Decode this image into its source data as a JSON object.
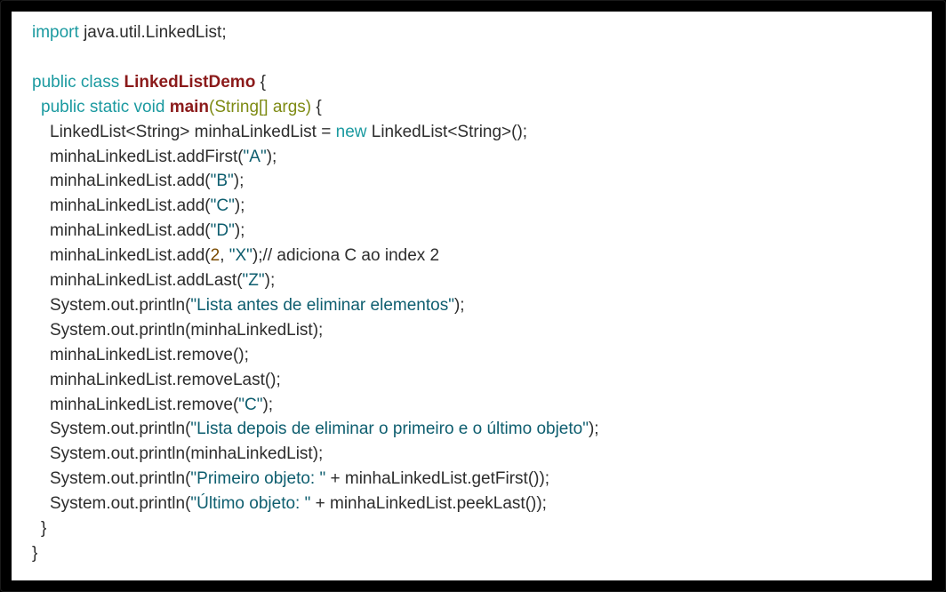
{
  "editor": {
    "lines": [
      {
        "indent": 0,
        "parts": [
          {
            "t": "kw",
            "v": "import"
          },
          {
            "t": "plain",
            "v": " java.util.LinkedList;"
          }
        ]
      },
      {
        "indent": 0,
        "parts": []
      },
      {
        "indent": 0,
        "parts": [
          {
            "t": "kw",
            "v": "public class "
          },
          {
            "t": "cls",
            "v": "LinkedListDemo"
          },
          {
            "t": "plain",
            "v": " {"
          }
        ]
      },
      {
        "indent": 1,
        "parts": [
          {
            "t": "kw",
            "v": "public static void "
          },
          {
            "t": "fn",
            "v": "main"
          },
          {
            "t": "type",
            "v": "(String[] args)"
          },
          {
            "t": "plain",
            "v": " {"
          }
        ]
      },
      {
        "indent": 2,
        "parts": [
          {
            "t": "plain",
            "v": "LinkedList<String> minhaLinkedList = "
          },
          {
            "t": "kw",
            "v": "new"
          },
          {
            "t": "plain",
            "v": " LinkedList<String>();"
          }
        ]
      },
      {
        "indent": 2,
        "parts": [
          {
            "t": "plain",
            "v": "minhaLinkedList.addFirst("
          },
          {
            "t": "str",
            "v": "\"A\""
          },
          {
            "t": "plain",
            "v": ");"
          }
        ]
      },
      {
        "indent": 2,
        "parts": [
          {
            "t": "plain",
            "v": "minhaLinkedList.add("
          },
          {
            "t": "str",
            "v": "\"B\""
          },
          {
            "t": "plain",
            "v": ");"
          }
        ]
      },
      {
        "indent": 2,
        "parts": [
          {
            "t": "plain",
            "v": "minhaLinkedList.add("
          },
          {
            "t": "str",
            "v": "\"C\""
          },
          {
            "t": "plain",
            "v": ");"
          }
        ]
      },
      {
        "indent": 2,
        "parts": [
          {
            "t": "plain",
            "v": "minhaLinkedList.add("
          },
          {
            "t": "str",
            "v": "\"D\""
          },
          {
            "t": "plain",
            "v": ");"
          }
        ]
      },
      {
        "indent": 2,
        "parts": [
          {
            "t": "plain",
            "v": "minhaLinkedList.add("
          },
          {
            "t": "num",
            "v": "2"
          },
          {
            "t": "plain",
            "v": ", "
          },
          {
            "t": "str",
            "v": "\"X\""
          },
          {
            "t": "plain",
            "v": ");// adiciona C ao index 2"
          }
        ]
      },
      {
        "indent": 2,
        "parts": [
          {
            "t": "plain",
            "v": "minhaLinkedList.addLast("
          },
          {
            "t": "str",
            "v": "\"Z\""
          },
          {
            "t": "plain",
            "v": ");"
          }
        ]
      },
      {
        "indent": 2,
        "parts": [
          {
            "t": "plain",
            "v": "System.out.println("
          },
          {
            "t": "str",
            "v": "\"Lista antes de eliminar elementos\""
          },
          {
            "t": "plain",
            "v": ");"
          }
        ]
      },
      {
        "indent": 2,
        "parts": [
          {
            "t": "plain",
            "v": "System.out.println(minhaLinkedList);"
          }
        ]
      },
      {
        "indent": 2,
        "parts": [
          {
            "t": "plain",
            "v": "minhaLinkedList.remove();"
          }
        ]
      },
      {
        "indent": 2,
        "parts": [
          {
            "t": "plain",
            "v": "minhaLinkedList.removeLast();"
          }
        ]
      },
      {
        "indent": 2,
        "parts": [
          {
            "t": "plain",
            "v": "minhaLinkedList.remove("
          },
          {
            "t": "str",
            "v": "\"C\""
          },
          {
            "t": "plain",
            "v": ");"
          }
        ]
      },
      {
        "indent": 2,
        "parts": [
          {
            "t": "plain",
            "v": "System.out.println("
          },
          {
            "t": "str",
            "v": "\"Lista depois de eliminar o primeiro e o último objeto\""
          },
          {
            "t": "plain",
            "v": ");"
          }
        ]
      },
      {
        "indent": 2,
        "parts": [
          {
            "t": "plain",
            "v": "System.out.println(minhaLinkedList);"
          }
        ]
      },
      {
        "indent": 2,
        "parts": [
          {
            "t": "plain",
            "v": "System.out.println("
          },
          {
            "t": "str",
            "v": "\"Primeiro objeto: \""
          },
          {
            "t": "plain",
            "v": " + minhaLinkedList.getFirst());"
          }
        ]
      },
      {
        "indent": 2,
        "parts": [
          {
            "t": "plain",
            "v": "System.out.println("
          },
          {
            "t": "str",
            "v": "\"Último objeto: \""
          },
          {
            "t": "plain",
            "v": " + minhaLinkedList.peekLast());"
          }
        ]
      },
      {
        "indent": 1,
        "parts": [
          {
            "t": "plain",
            "v": "}"
          }
        ]
      },
      {
        "indent": 0,
        "parts": [
          {
            "t": "plain",
            "v": "}"
          }
        ]
      }
    ]
  },
  "colors": {
    "background": "#000000",
    "panel": "#ffffff",
    "keyword": "#1b9aa0",
    "class_name": "#8b1a1a",
    "type": "#7d8a12",
    "string": "#0e5e6f",
    "text": "#2d2d2d"
  }
}
